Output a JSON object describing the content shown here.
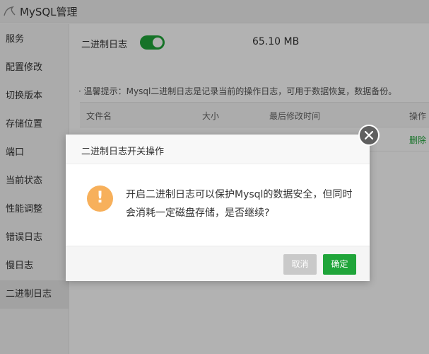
{
  "app": {
    "title": "MySQL管理"
  },
  "sidebar": {
    "items": [
      {
        "label": "服务"
      },
      {
        "label": "配置修改"
      },
      {
        "label": "切换版本"
      },
      {
        "label": "存储位置"
      },
      {
        "label": "端口"
      },
      {
        "label": "当前状态"
      },
      {
        "label": "性能调整"
      },
      {
        "label": "错误日志"
      },
      {
        "label": "慢日志"
      },
      {
        "label": "二进制日志",
        "active": true
      }
    ]
  },
  "binlog": {
    "label": "二进制日志",
    "enabled": true,
    "size": "65.10 MB",
    "tip": "· 温馨提示：Mysql二进制日志是记录当前的操作日志，可用于数据恢复，数据备份。"
  },
  "table": {
    "columns": [
      "文件名",
      "大小",
      "最后修改时间",
      "操作"
    ],
    "rows": [
      {
        "action": "删除"
      }
    ]
  },
  "dialog": {
    "title": "二进制日志开关操作",
    "message": "开启二进制日志可以保护Mysql的数据安全，但同时会消耗一定磁盘存储，是否继续?",
    "icon": "warning-icon",
    "cancel_label": "取消",
    "confirm_label": "确定"
  },
  "colors": {
    "accent": "#20a53a",
    "warning": "#f7b05b",
    "close": "#5f5f5f"
  }
}
